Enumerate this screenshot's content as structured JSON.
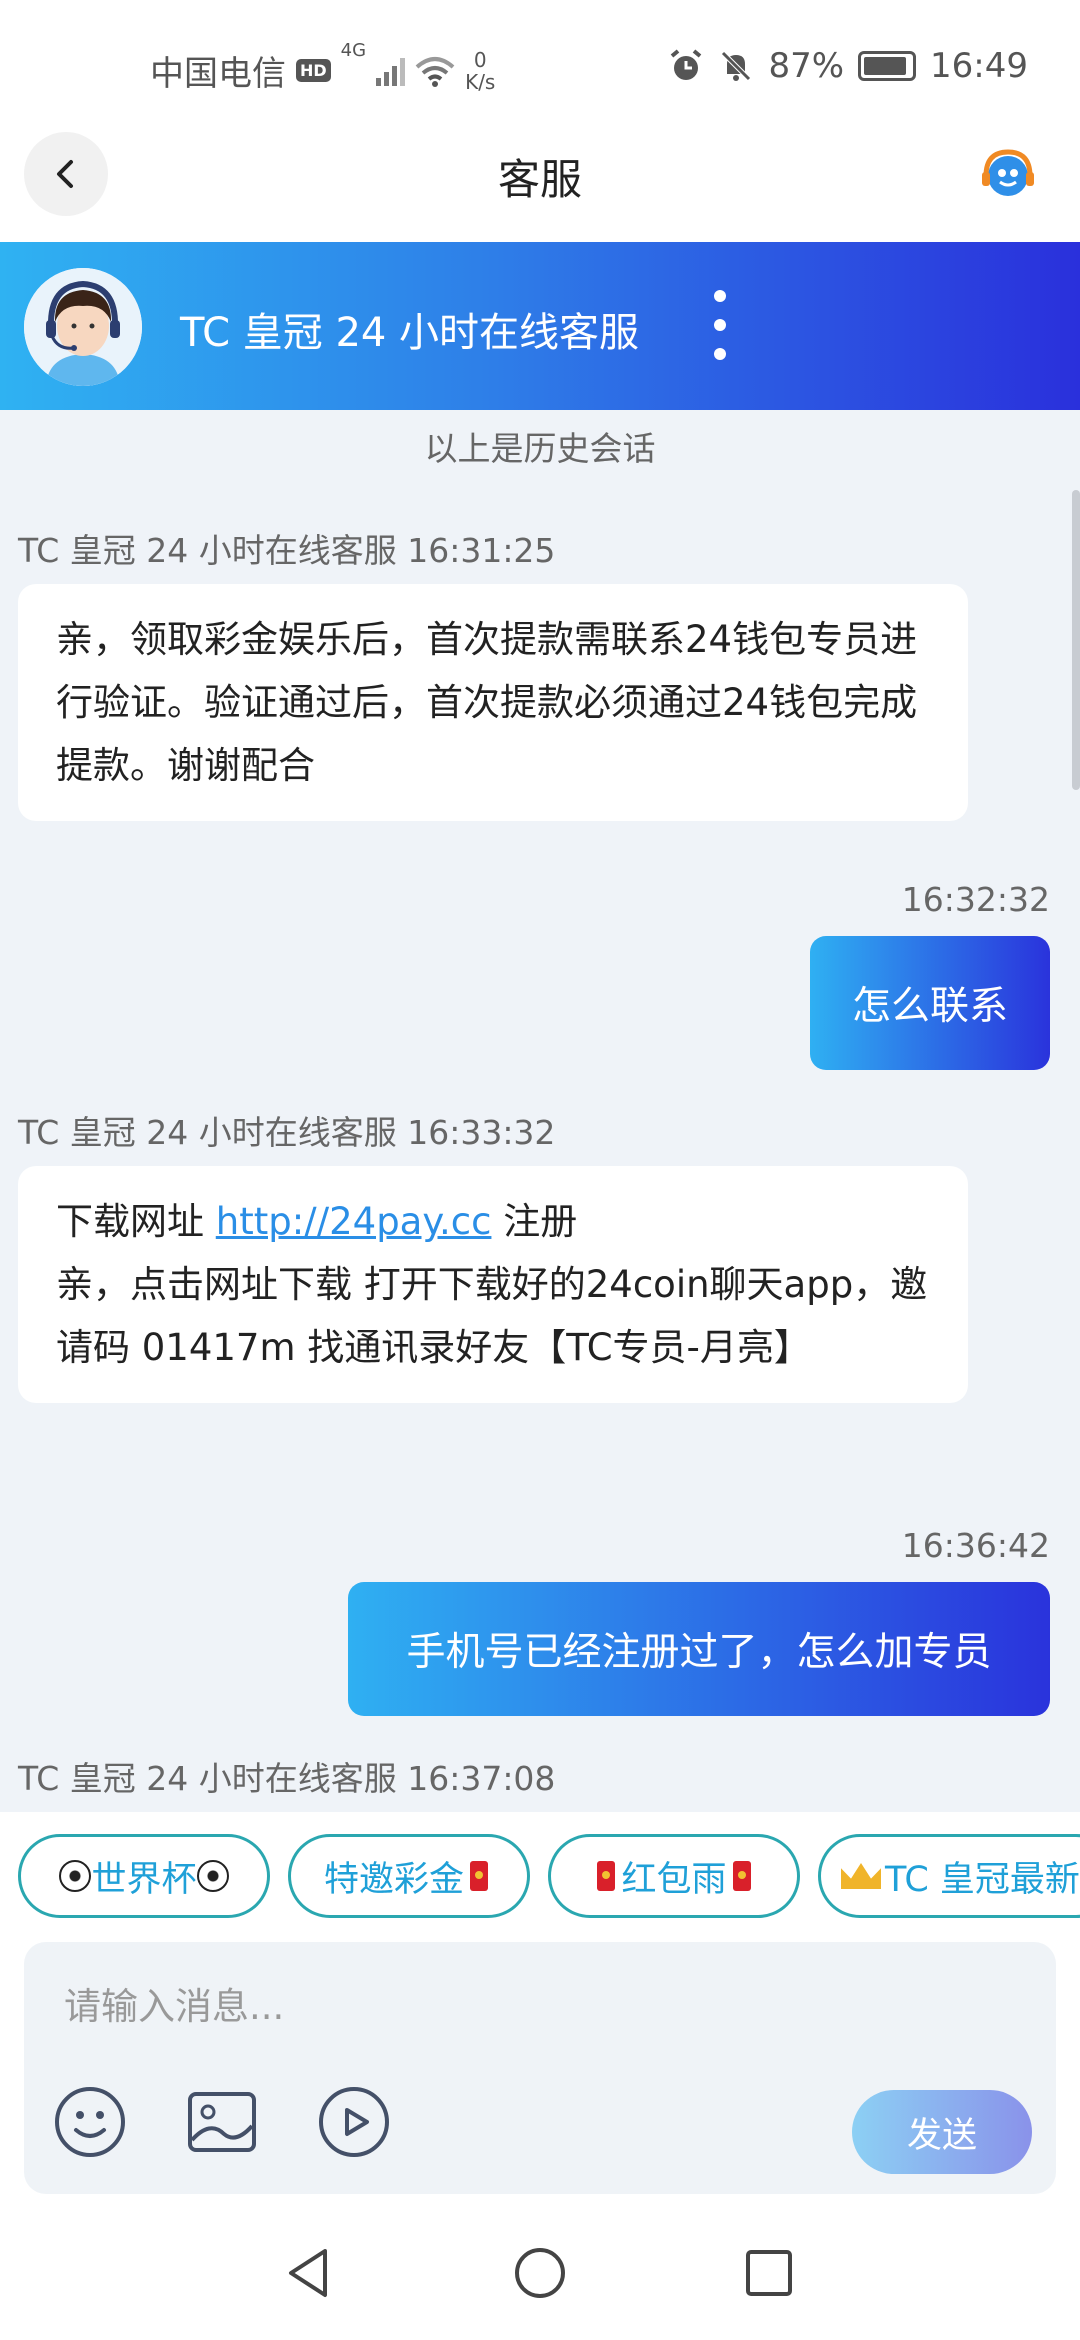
{
  "status_bar": {
    "carrier": "中国电信",
    "hd_badge": "HD",
    "network": "4G",
    "speed_value": "0",
    "speed_unit": "K/s",
    "battery": "87%",
    "time": "16:49"
  },
  "header": {
    "title": "客服"
  },
  "agent": {
    "name": "TC 皇冠 24 小时在线客服"
  },
  "chat": {
    "history_note": "以上是历史会话",
    "messages": [
      {
        "from": "agent",
        "meta": "TC 皇冠 24 小时在线客服 16:31:25",
        "text": "亲，领取彩金娱乐后，首次提款需联系24钱包专员进行验证。验证通过后，首次提款必须通过24钱包完成提款。谢谢配合"
      },
      {
        "from": "user",
        "meta": "16:32:32",
        "text": "怎么联系"
      },
      {
        "from": "agent",
        "meta": "TC 皇冠 24 小时在线客服 16:33:32",
        "line1_prefix": "下载网址",
        "link": "http://24pay.cc",
        "line1_suffix": "注册",
        "text": "亲，点击网址下载 打开下载好的24coin聊天app，邀请码 01417m  找通讯录好友【TC专员-月亮】"
      },
      {
        "from": "user",
        "meta": "16:36:42",
        "text": "手机号已经注册过了，怎么加专员"
      },
      {
        "from": "agent",
        "meta": "TC 皇冠 24 小时在线客服 16:37:08"
      }
    ]
  },
  "quick_replies": [
    "世界杯",
    "特邀彩金",
    "红包雨",
    "TC 皇冠最新"
  ],
  "composer": {
    "placeholder": "请输入消息...",
    "send_label": "发送"
  },
  "colors": {
    "accent_start": "#2fb2f2",
    "accent_end": "#2a30dc",
    "chip_border": "#2aa7b0",
    "link": "#2a8ee6"
  }
}
